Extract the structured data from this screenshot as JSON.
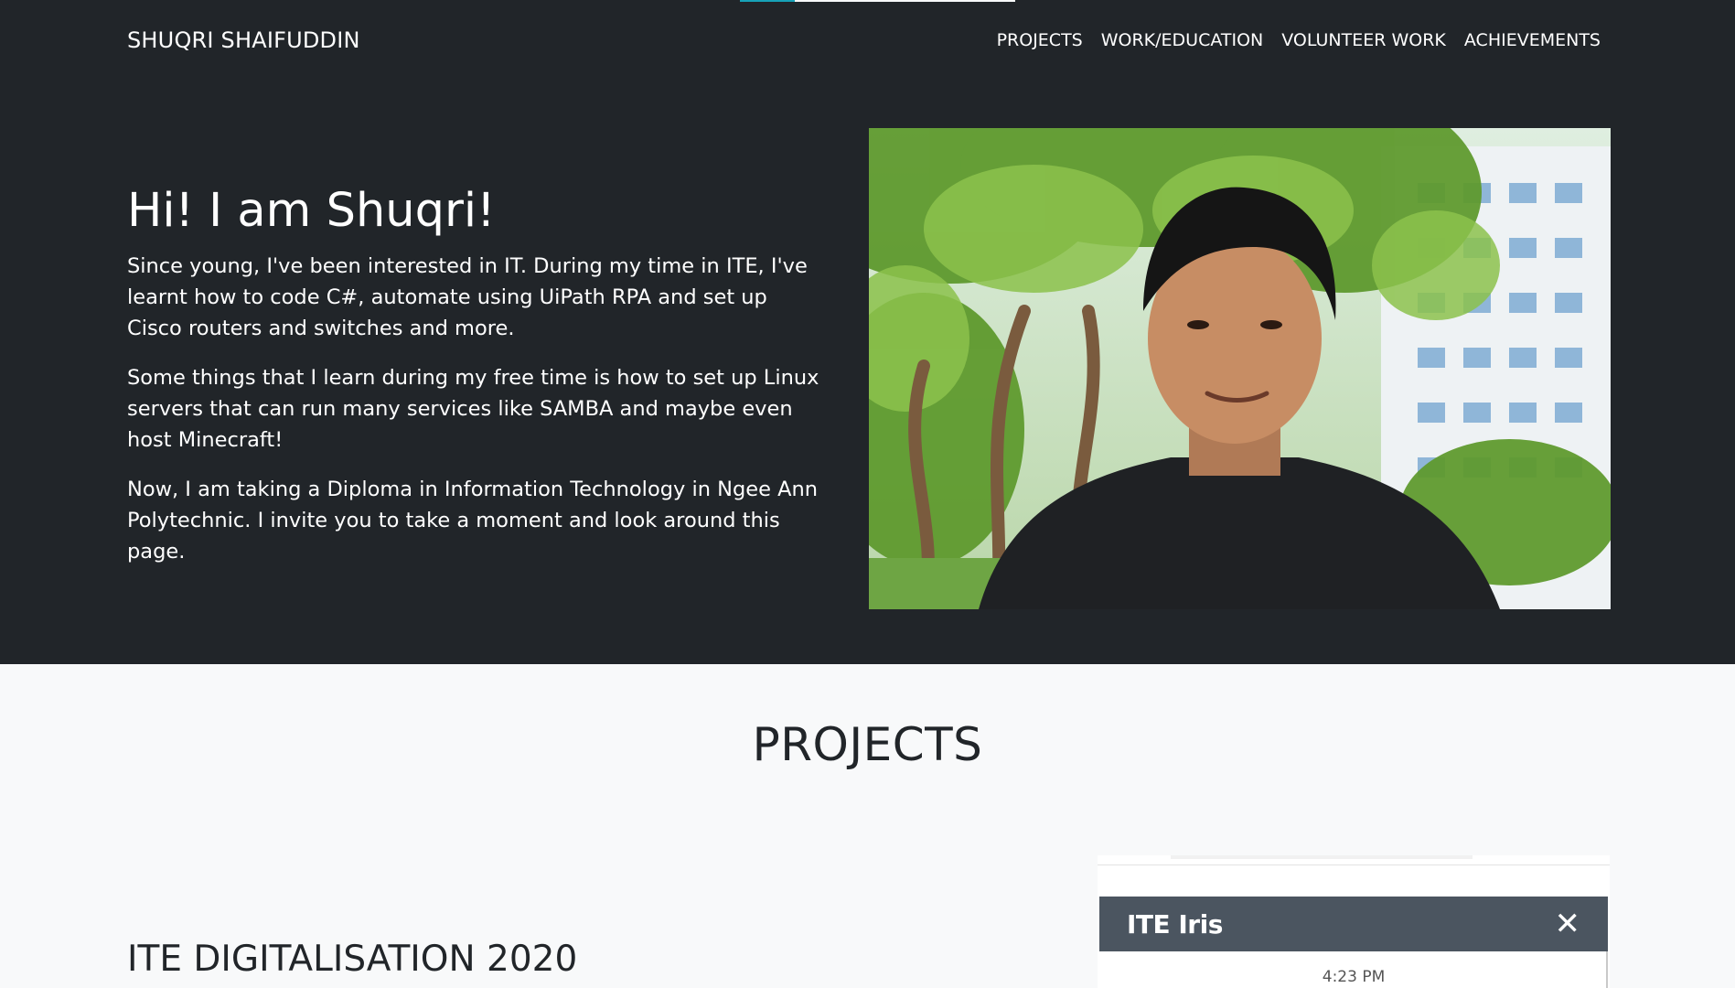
{
  "brand": "SHUQRI SHAIFUDDIN",
  "nav": [
    "PROJECTS",
    "WORK/EDUCATION",
    "VOLUNTEER WORK",
    "ACHIEVEMENTS"
  ],
  "scroll_progress": 0.2,
  "hero": {
    "title": "Hi! I am Shuqri!",
    "paragraphs": [
      "Since young, I've been interested in IT. During my time in ITE, I've learnt how to code C#, automate using UiPath RPA and set up Cisco routers and switches and more.",
      "Some things that I learn during my free time is how to set up Linux servers that can run many services like SAMBA and maybe even host Minecraft!",
      "Now, I am taking a Diploma in Information Technology in Ngee Ann Polytechnic. I invite you to take a moment and look around this page."
    ]
  },
  "projects": {
    "section_title": "PROJECTS",
    "items": [
      {
        "title": "ITE DIGITALISATION 2020",
        "screenshot": {
          "app_name": "ITE Iris",
          "time": "4:23 PM",
          "close_icon": "close-icon"
        }
      }
    ]
  },
  "colors": {
    "dark_bg": "#212529",
    "light_bg": "#f8f9fa",
    "progress_accent": "#17a2b8",
    "chat_header": "#4b5560"
  }
}
